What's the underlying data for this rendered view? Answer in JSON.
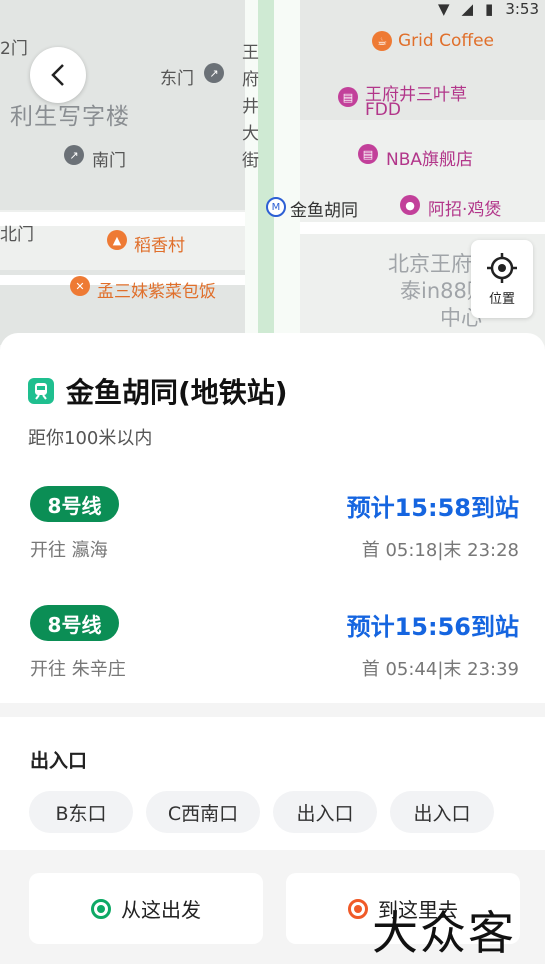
{
  "status": {
    "time": "3:53"
  },
  "map": {
    "labels": {
      "gate2": "2门",
      "east_gate": "东门",
      "lisheng": "利生写字楼",
      "south_gate": "南门",
      "north_gate": "北门",
      "daoxiang": "稻香村",
      "mengsanmei": "孟三妹紫菜包饭",
      "wangfujing_street": "王府井大街",
      "jinyu_hutong": "金鱼胡同",
      "grid_coffee": "Grid Coffee",
      "sanyecao_1": "王府井三叶草",
      "sanyecao_2": "FDD",
      "nba": "NBA旗舰店",
      "azhao": "阿招·鸡煲",
      "beijing_1": "北京王府井银",
      "beijing_2": "泰in88购物",
      "beijing_3": "中心"
    },
    "location_button_label": "位置"
  },
  "station": {
    "name": "金鱼胡同(地铁站)",
    "distance": "距你100米以内",
    "lines": [
      {
        "badge": "8号线",
        "direction": "开往 瀛海",
        "eta": "预计15:58到站",
        "times": "首 05:18|末 23:28"
      },
      {
        "badge": "8号线",
        "direction": "开往 朱辛庄",
        "eta": "预计15:56到站",
        "times": "首 05:44|末 23:39"
      }
    ]
  },
  "exits": {
    "title": "出入口",
    "items": [
      "B东口",
      "C西南口",
      "出入口",
      "出入口"
    ]
  },
  "actions": {
    "from_here": "从这出发",
    "to_here": "到这里去"
  },
  "watermark": "大众客",
  "colors": {
    "line8": "#0b8e55",
    "eta": "#1565e0",
    "from_dot": "#0ea965",
    "to_dot": "#f05a28"
  }
}
